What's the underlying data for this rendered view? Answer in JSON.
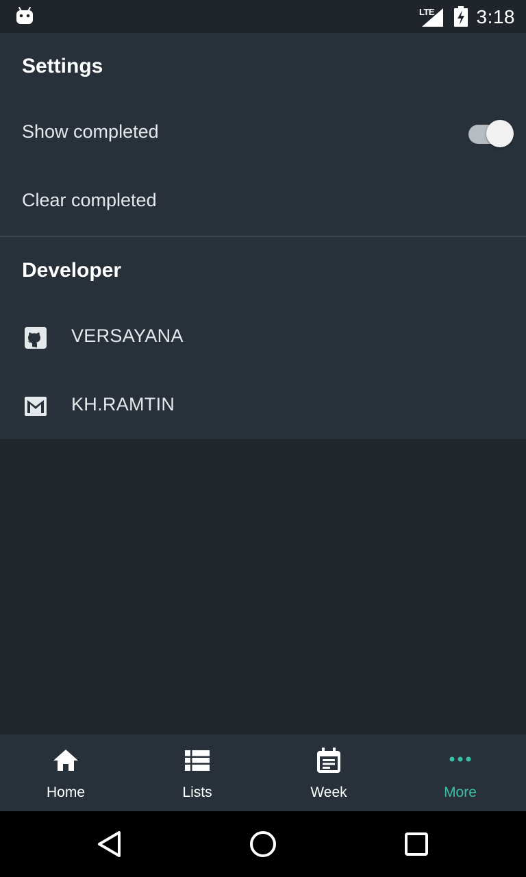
{
  "status_bar": {
    "network": "LTE",
    "time": "3:18",
    "icons": [
      "android-icon",
      "signal-icon",
      "battery-charging-icon"
    ]
  },
  "settings": {
    "title": "Settings",
    "show_completed": {
      "label": "Show completed",
      "enabled": true
    },
    "clear_completed": {
      "label": "Clear completed"
    }
  },
  "developer": {
    "title": "Developer",
    "items": [
      {
        "icon": "github-icon",
        "label": "VERSAYANA"
      },
      {
        "icon": "gmail-icon",
        "label": "KH.RAMTIN"
      }
    ]
  },
  "bottom_nav": {
    "items": [
      {
        "icon": "home-icon",
        "label": "Home"
      },
      {
        "icon": "list-icon",
        "label": "Lists"
      },
      {
        "icon": "calendar-icon",
        "label": "Week"
      },
      {
        "icon": "more-icon",
        "label": "More"
      }
    ],
    "active": "More"
  },
  "colors": {
    "accent": "#3bbfa4",
    "panel": "#28313a",
    "background": "#22272d",
    "status_bar": "#20252b"
  }
}
